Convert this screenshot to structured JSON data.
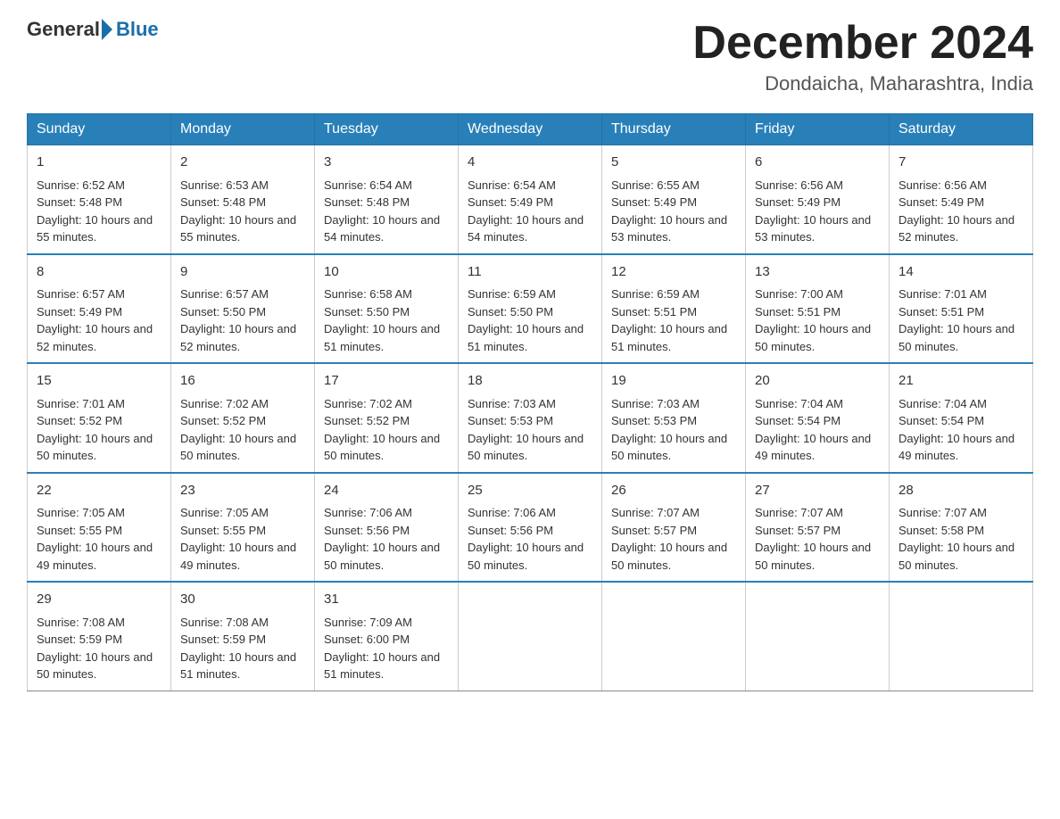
{
  "header": {
    "logo_general": "General",
    "logo_blue": "Blue",
    "month_title": "December 2024",
    "location": "Dondaicha, Maharashtra, India"
  },
  "days_of_week": [
    "Sunday",
    "Monday",
    "Tuesday",
    "Wednesday",
    "Thursday",
    "Friday",
    "Saturday"
  ],
  "weeks": [
    [
      {
        "day": 1,
        "sunrise": "6:52 AM",
        "sunset": "5:48 PM",
        "daylight": "10 hours and 55 minutes."
      },
      {
        "day": 2,
        "sunrise": "6:53 AM",
        "sunset": "5:48 PM",
        "daylight": "10 hours and 55 minutes."
      },
      {
        "day": 3,
        "sunrise": "6:54 AM",
        "sunset": "5:48 PM",
        "daylight": "10 hours and 54 minutes."
      },
      {
        "day": 4,
        "sunrise": "6:54 AM",
        "sunset": "5:49 PM",
        "daylight": "10 hours and 54 minutes."
      },
      {
        "day": 5,
        "sunrise": "6:55 AM",
        "sunset": "5:49 PM",
        "daylight": "10 hours and 53 minutes."
      },
      {
        "day": 6,
        "sunrise": "6:56 AM",
        "sunset": "5:49 PM",
        "daylight": "10 hours and 53 minutes."
      },
      {
        "day": 7,
        "sunrise": "6:56 AM",
        "sunset": "5:49 PM",
        "daylight": "10 hours and 52 minutes."
      }
    ],
    [
      {
        "day": 8,
        "sunrise": "6:57 AM",
        "sunset": "5:49 PM",
        "daylight": "10 hours and 52 minutes."
      },
      {
        "day": 9,
        "sunrise": "6:57 AM",
        "sunset": "5:50 PM",
        "daylight": "10 hours and 52 minutes."
      },
      {
        "day": 10,
        "sunrise": "6:58 AM",
        "sunset": "5:50 PM",
        "daylight": "10 hours and 51 minutes."
      },
      {
        "day": 11,
        "sunrise": "6:59 AM",
        "sunset": "5:50 PM",
        "daylight": "10 hours and 51 minutes."
      },
      {
        "day": 12,
        "sunrise": "6:59 AM",
        "sunset": "5:51 PM",
        "daylight": "10 hours and 51 minutes."
      },
      {
        "day": 13,
        "sunrise": "7:00 AM",
        "sunset": "5:51 PM",
        "daylight": "10 hours and 50 minutes."
      },
      {
        "day": 14,
        "sunrise": "7:01 AM",
        "sunset": "5:51 PM",
        "daylight": "10 hours and 50 minutes."
      }
    ],
    [
      {
        "day": 15,
        "sunrise": "7:01 AM",
        "sunset": "5:52 PM",
        "daylight": "10 hours and 50 minutes."
      },
      {
        "day": 16,
        "sunrise": "7:02 AM",
        "sunset": "5:52 PM",
        "daylight": "10 hours and 50 minutes."
      },
      {
        "day": 17,
        "sunrise": "7:02 AM",
        "sunset": "5:52 PM",
        "daylight": "10 hours and 50 minutes."
      },
      {
        "day": 18,
        "sunrise": "7:03 AM",
        "sunset": "5:53 PM",
        "daylight": "10 hours and 50 minutes."
      },
      {
        "day": 19,
        "sunrise": "7:03 AM",
        "sunset": "5:53 PM",
        "daylight": "10 hours and 50 minutes."
      },
      {
        "day": 20,
        "sunrise": "7:04 AM",
        "sunset": "5:54 PM",
        "daylight": "10 hours and 49 minutes."
      },
      {
        "day": 21,
        "sunrise": "7:04 AM",
        "sunset": "5:54 PM",
        "daylight": "10 hours and 49 minutes."
      }
    ],
    [
      {
        "day": 22,
        "sunrise": "7:05 AM",
        "sunset": "5:55 PM",
        "daylight": "10 hours and 49 minutes."
      },
      {
        "day": 23,
        "sunrise": "7:05 AM",
        "sunset": "5:55 PM",
        "daylight": "10 hours and 49 minutes."
      },
      {
        "day": 24,
        "sunrise": "7:06 AM",
        "sunset": "5:56 PM",
        "daylight": "10 hours and 50 minutes."
      },
      {
        "day": 25,
        "sunrise": "7:06 AM",
        "sunset": "5:56 PM",
        "daylight": "10 hours and 50 minutes."
      },
      {
        "day": 26,
        "sunrise": "7:07 AM",
        "sunset": "5:57 PM",
        "daylight": "10 hours and 50 minutes."
      },
      {
        "day": 27,
        "sunrise": "7:07 AM",
        "sunset": "5:57 PM",
        "daylight": "10 hours and 50 minutes."
      },
      {
        "day": 28,
        "sunrise": "7:07 AM",
        "sunset": "5:58 PM",
        "daylight": "10 hours and 50 minutes."
      }
    ],
    [
      {
        "day": 29,
        "sunrise": "7:08 AM",
        "sunset": "5:59 PM",
        "daylight": "10 hours and 50 minutes."
      },
      {
        "day": 30,
        "sunrise": "7:08 AM",
        "sunset": "5:59 PM",
        "daylight": "10 hours and 51 minutes."
      },
      {
        "day": 31,
        "sunrise": "7:09 AM",
        "sunset": "6:00 PM",
        "daylight": "10 hours and 51 minutes."
      },
      null,
      null,
      null,
      null
    ]
  ]
}
